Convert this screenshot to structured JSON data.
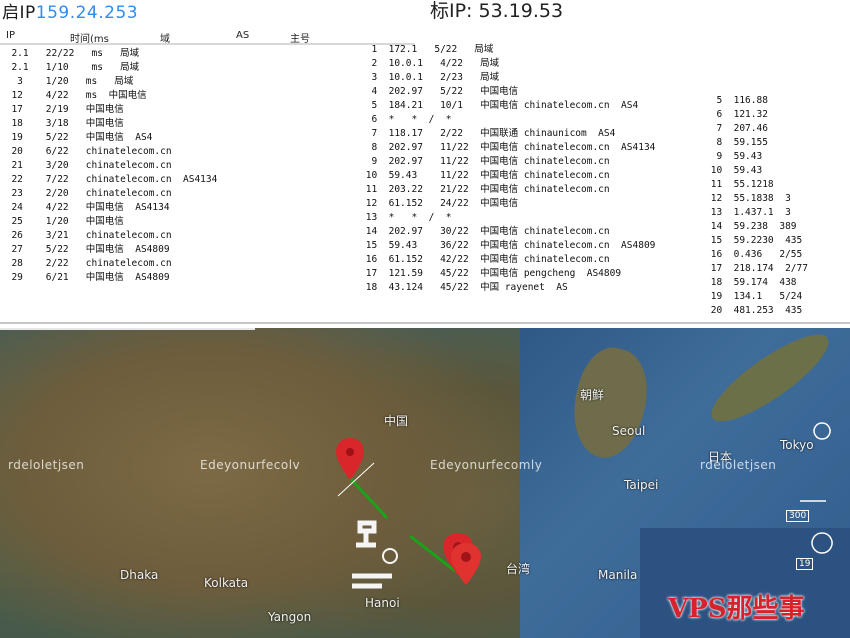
{
  "panel": {
    "title_prefix": "启IP",
    "title_ip": "159.24.253",
    "title_right": "标IP: 53.19.53",
    "headers": [
      "IP",
      "时间(ms",
      "域",
      "AS",
      "主号"
    ],
    "rows_left": [
      "  2.1   22/22   ms   局域  ",
      "  2.1   1/10    ms   局域  ",
      "   3    1/20   ms   局域  ",
      "  12    4/22   ms  中国电信  ",
      "  17    2/19   中国电信  ",
      "  18    3/18   中国电信  ",
      "  19    5/22   中国电信  AS4",
      "  20    6/22   chinatelecom.cn  ",
      "  21    3/20   chinatelecom.cn  ",
      "  22    7/22   chinatelecom.cn  AS4134",
      "  23    2/20   chinatelecom.cn  ",
      "  24    4/22   中国电信  AS4134",
      "  25    1/20   中国电信  ",
      "  26    3/21   chinatelecom.cn  ",
      "  27    5/22   中国电信  AS4809",
      "  28    2/22   chinatelecom.cn  ",
      "  29    6/21   中国电信  AS4809"
    ],
    "rows_mid": [
      "  1  172.1   5/22   局域",
      "  2  10.0.1   4/22   局域",
      "  3  10.0.1   2/23   局域",
      "  4  202.97   5/22   中国电信",
      "  5  184.21   10/1   中国电信 chinatelecom.cn  AS4",
      "  6  *   *  /  *",
      "  7  118.17   2/22   中国联通 chinaunicom  AS4",
      "  8  202.97   11/22  中国电信 chinatelecom.cn  AS4134",
      "  9  202.97   11/22  中国电信 chinatelecom.cn",
      " 10  59.43    11/22  中国电信 chinatelecom.cn",
      " 11  203.22   21/22  中国电信 chinatelecom.cn",
      " 12  61.152   24/22  中国电信",
      " 13  *   *  /  *",
      " 14  202.97   30/22  中国电信 chinatelecom.cn",
      " 15  59.43    36/22  中国电信 chinatelecom.cn  AS4809",
      " 16  61.152   42/22  中国电信 chinatelecom.cn",
      " 17  121.59   45/22  中国电信 pengcheng  AS4809",
      " 18  43.124   45/22  中国 rayenet  AS"
    ],
    "rows_right": [
      "  5  116.88",
      "  6  121.32",
      "  7  207.46",
      "  8  59.155",
      "  9  59.43",
      " 10  59.43",
      " 11  55.1218",
      " 12  55.1838  3",
      " 13  1.437.1  3",
      " 14  59.238  389",
      " 15  59.2230  435",
      " 16  0.436   2/55",
      " 17  218.174  2/77",
      " 18  59.174  438",
      " 19  134.1   5/24",
      " 20  481.253  435"
    ]
  },
  "map": {
    "labels": [
      "中国",
      "台湾",
      "日本",
      "朝鲜",
      "Dhaka",
      "Kolkata",
      "Hanoi",
      "Manila",
      "Yangon",
      "Taipei",
      "Seoul",
      "Tokyo"
    ],
    "watermarks": [
      "rdeloletjsen",
      "Edeyonurfecolv",
      "Edeyonurfecomly",
      "rdeloletjsen"
    ],
    "scale_text": [
      "300",
      "19"
    ],
    "markers": [
      "start-marker",
      "hop-marker",
      "end-marker"
    ],
    "brand": "VPS那些事"
  }
}
